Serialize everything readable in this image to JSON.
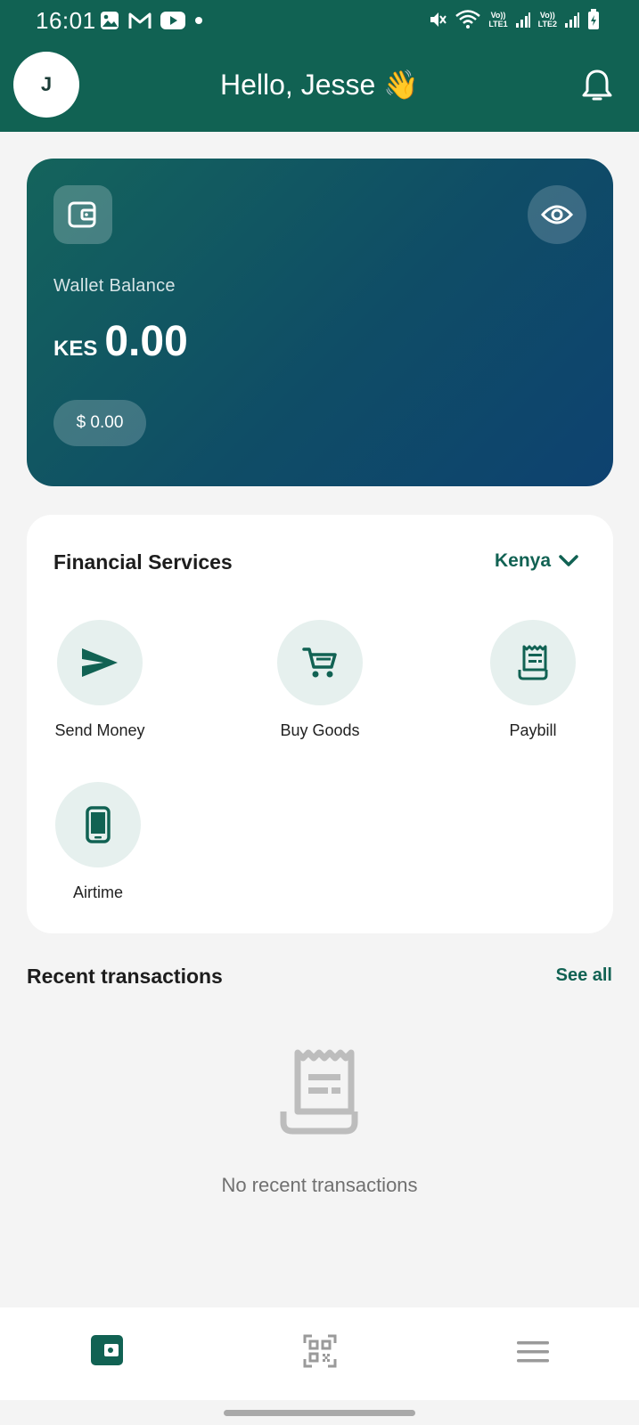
{
  "status_bar": {
    "time": "16:01",
    "left_icons": [
      "gallery-icon",
      "gmail-icon",
      "youtube-icon",
      "dot-icon"
    ],
    "right_icons": [
      "mute-icon",
      "wifi-icon",
      "volte-lte1-icon",
      "signal-icon",
      "volte-lte2-icon",
      "signal-icon",
      "battery-icon"
    ],
    "lte1_top": "Vo))",
    "lte1_bottom": "LTE1",
    "lte2_top": "Vo))",
    "lte2_bottom": "LTE2"
  },
  "header": {
    "avatar_initial": "J",
    "greeting": "Hello, Jesse",
    "greeting_emoji": "👋",
    "bell_icon": "bell-icon"
  },
  "wallet": {
    "icon": "wallet-icon",
    "visibility_icon": "eye-icon",
    "label": "Wallet Balance",
    "currency": "KES",
    "amount": "0.00",
    "usd_balance": "$ 0.00"
  },
  "services": {
    "title": "Financial Services",
    "country": "Kenya",
    "items": [
      {
        "label": "Send Money",
        "icon": "send-icon"
      },
      {
        "label": "Buy Goods",
        "icon": "cart-icon"
      },
      {
        "label": "Paybill",
        "icon": "receipt-icon"
      },
      {
        "label": "Airtime",
        "icon": "phone-icon"
      }
    ]
  },
  "recent": {
    "title": "Recent transactions",
    "see_all": "See all",
    "empty_text": "No recent transactions",
    "empty_icon": "receipt-icon"
  },
  "bottom_nav": {
    "items": [
      {
        "icon": "wallet-icon",
        "active": true
      },
      {
        "icon": "qr-code-icon",
        "active": false
      },
      {
        "icon": "menu-icon",
        "active": false
      }
    ]
  },
  "colors": {
    "primary": "#116253",
    "card_gradient_start": "#14645c",
    "card_gradient_end": "#0e4270",
    "service_circle": "#e6f0ee",
    "background": "#f4f4f4"
  }
}
